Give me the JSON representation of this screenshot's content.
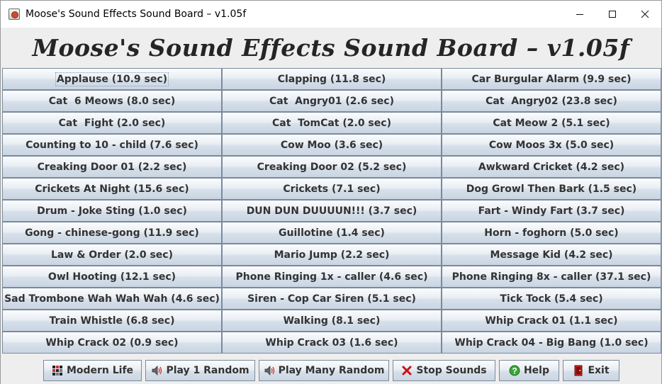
{
  "window": {
    "title": "Moose's Sound Effects Sound Board – v1.05f"
  },
  "header": {
    "title": "Moose's Sound Effects Sound Board – v1.05f"
  },
  "sounds": [
    "Applause (10.9 sec)",
    "Clapping (11.8 sec)",
    "Car Burgular Alarm (9.9 sec)",
    "Cat  6 Meows (8.0 sec)",
    "Cat  Angry01 (2.6 sec)",
    "Cat  Angry02 (23.8 sec)",
    "Cat  Fight (2.0 sec)",
    "Cat  TomCat (2.0 sec)",
    "Cat Meow 2 (5.1 sec)",
    "Counting to 10 - child (7.6 sec)",
    "Cow Moo (3.6 sec)",
    "Cow Moos 3x (5.0 sec)",
    "Creaking Door 01 (2.2 sec)",
    "Creaking Door 02 (5.2 sec)",
    "Awkward Cricket (4.2 sec)",
    "Crickets At Night (15.6 sec)",
    "Crickets (7.1 sec)",
    "Dog Growl Then Bark (1.5 sec)",
    "Drum - Joke Sting (1.0 sec)",
    "DUN DUN DUUUUN!!! (3.7 sec)",
    "Fart - Windy Fart (3.7 sec)",
    "Gong - chinese-gong (11.9 sec)",
    "Guillotine (1.4 sec)",
    "Horn - foghorn (5.0 sec)",
    "Law & Order (2.0 sec)",
    "Mario Jump (2.2 sec)",
    "Message Kid (4.2 sec)",
    "Owl Hooting (12.1 sec)",
    "Phone Ringing 1x - caller (4.6 sec)",
    "Phone Ringing 8x - caller (37.1 sec)",
    "Sad Trombone Wah Wah Wah (4.6 sec)",
    "Siren - Cop Car Siren (5.1 sec)",
    "Tick Tock (5.4 sec)",
    "Train Whistle (6.8 sec)",
    "Walking (8.1 sec)",
    "Whip Crack 01 (1.1 sec)",
    "Whip Crack 02 (0.9 sec)",
    "Whip Crack 03 (1.6 sec)",
    "Whip Crack 04 - Big Bang (1.0 sec)"
  ],
  "focused_index": 0,
  "actions": [
    {
      "label": "Modern Life",
      "icon": "modern-life-icon"
    },
    {
      "label": "Play 1 Random",
      "icon": "speaker-icon"
    },
    {
      "label": "Play Many Random",
      "icon": "speaker-icon"
    },
    {
      "label": "Stop Sounds",
      "icon": "red-x-icon"
    },
    {
      "label": "Help",
      "icon": "help-icon"
    },
    {
      "label": "Exit",
      "icon": "exit-icon"
    }
  ],
  "colors": {
    "button_gradient_top": "#fbfcfd",
    "button_gradient_bottom": "#c9d5e2",
    "button_border": "#7a8a9c",
    "button_text": "#333333",
    "stop_icon": "#cc1111",
    "help_icon": "#3aa53a",
    "exit_icon": "#c41e1e"
  }
}
